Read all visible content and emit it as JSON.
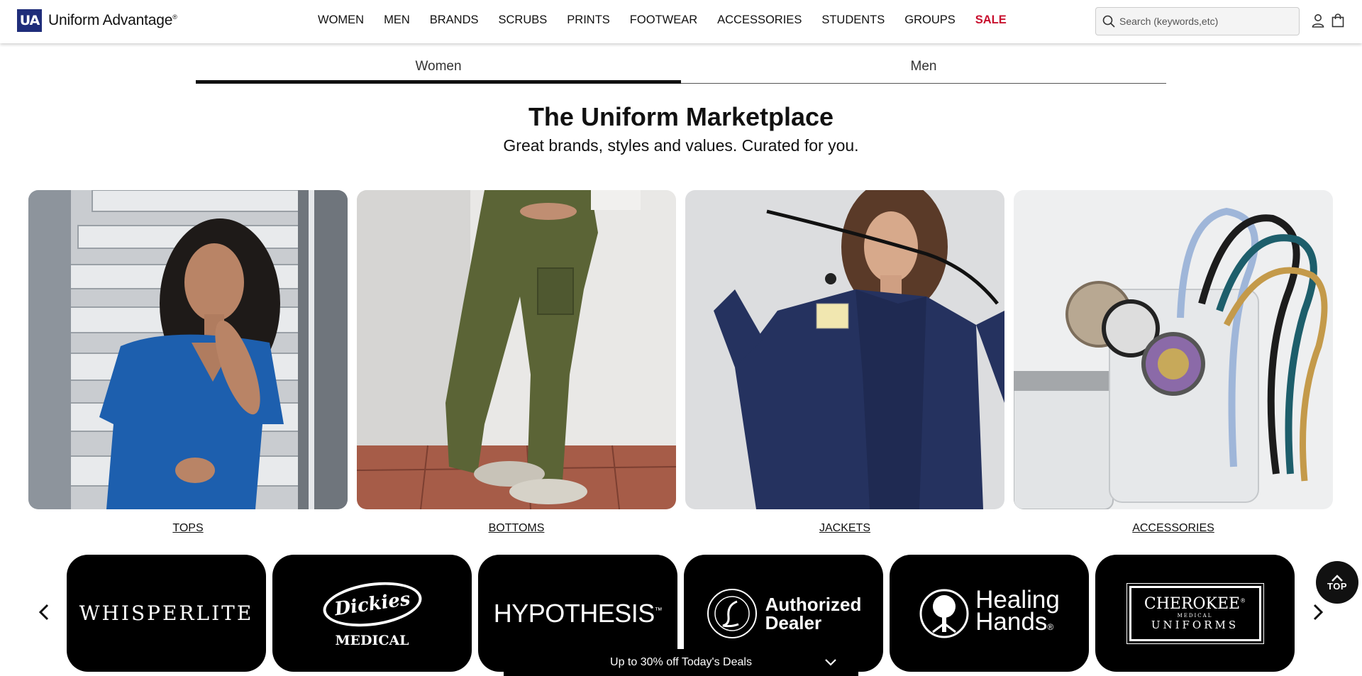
{
  "header": {
    "logo_mark": "UA",
    "logo_text": "Uniform Advantage",
    "logo_trademark": "®",
    "nav": [
      "WOMEN",
      "MEN",
      "BRANDS",
      "SCRUBS",
      "PRINTS",
      "FOOTWEAR",
      "ACCESSORIES",
      "STUDENTS",
      "GROUPS",
      "SALE"
    ],
    "search_placeholder": "Search (keywords,etc)"
  },
  "tabs": [
    "Women",
    "Men"
  ],
  "hero": {
    "title": "The Uniform Marketplace",
    "subtitle": "Great brands, styles and values. Curated for you."
  },
  "categories": [
    "TOPS",
    "BOTTOMS",
    "JACKETS",
    "ACCESSORIES"
  ],
  "brands": {
    "whisperlite": "WHISPERLITE",
    "dickies": "Dickies",
    "dickies_sub": "MEDICAL",
    "hypothesis": "HYPOTHESIS",
    "hypothesis_tm": "™",
    "littmann_line1": "Authorized",
    "littmann_line2": "Dealer",
    "healing_line1": "Healing",
    "healing_line2": "Hands",
    "healing_reg": "®",
    "cherokee": "CHEROKEE",
    "cherokee_reg": "®",
    "cherokee_mid": "MEDICAL",
    "cherokee_sub": "UNIFORMS"
  },
  "top_button": "TOP",
  "deals_bar": "Up to 30% off Today's Deals",
  "colors": {
    "brand_navy": "#1f2d7a",
    "sale_red": "#c8102e",
    "dark": "#000000"
  }
}
